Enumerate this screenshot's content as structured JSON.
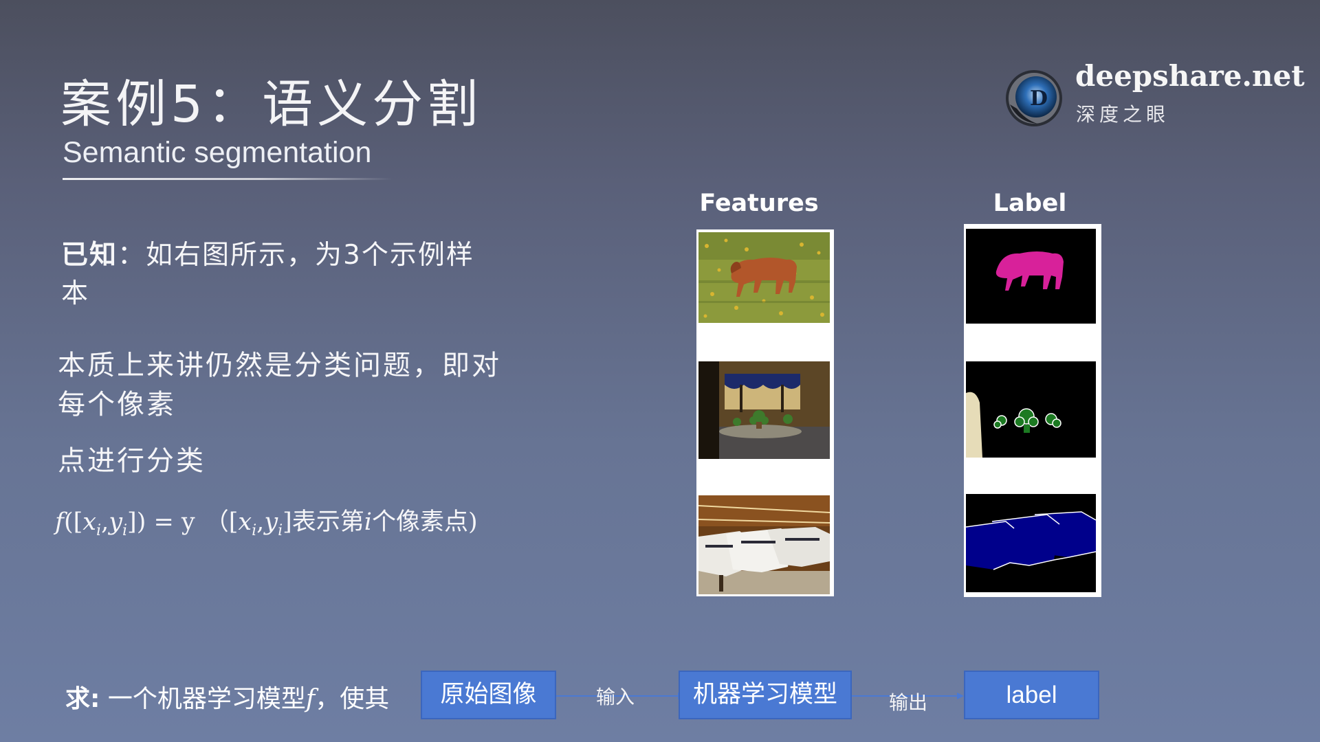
{
  "slide": {
    "title": "案例5：语义分割",
    "subtitle": "Semantic segmentation"
  },
  "brand": {
    "name": "deepshare.net",
    "subtitle": "深度之眼",
    "logo_icon": "eye-logo-icon"
  },
  "given": {
    "label": "已知",
    "text": "：如右图所示，为3个示例样本"
  },
  "essence": {
    "line1": "本质上来讲仍然是分类问题，即对每个像素",
    "line2": "点进行分类"
  },
  "formula": {
    "f": "f",
    "open": "([",
    "x": "x",
    "y": "y",
    "sub": "i",
    "comma": ",",
    "close": "]) = y",
    "paren_open": "（[",
    "paren_close": "]表示第",
    "i": "i",
    "tail": "个像素点)"
  },
  "figure": {
    "features_label": "Features",
    "label_label": "Label",
    "feature_images": [
      "horse-photo",
      "room-plants-photo",
      "boats-photo"
    ],
    "label_images": [
      "horse-mask",
      "plants-mask",
      "boats-mask"
    ],
    "colors": {
      "horse": "#d8219a",
      "plants": "#1c7a22",
      "boat": "#00008b",
      "background": "#000000",
      "wall": "#e6dcb8"
    }
  },
  "ask": {
    "label": "求:",
    "text_before": " 一个机器学习模型",
    "f": "f",
    "text_after": "，使其"
  },
  "flow": {
    "input_box": "原始图像",
    "input_label": "输入",
    "model_box": "机器学习模型",
    "output_label": "输出",
    "output_box": "label",
    "box_color": "#4a79d3"
  }
}
